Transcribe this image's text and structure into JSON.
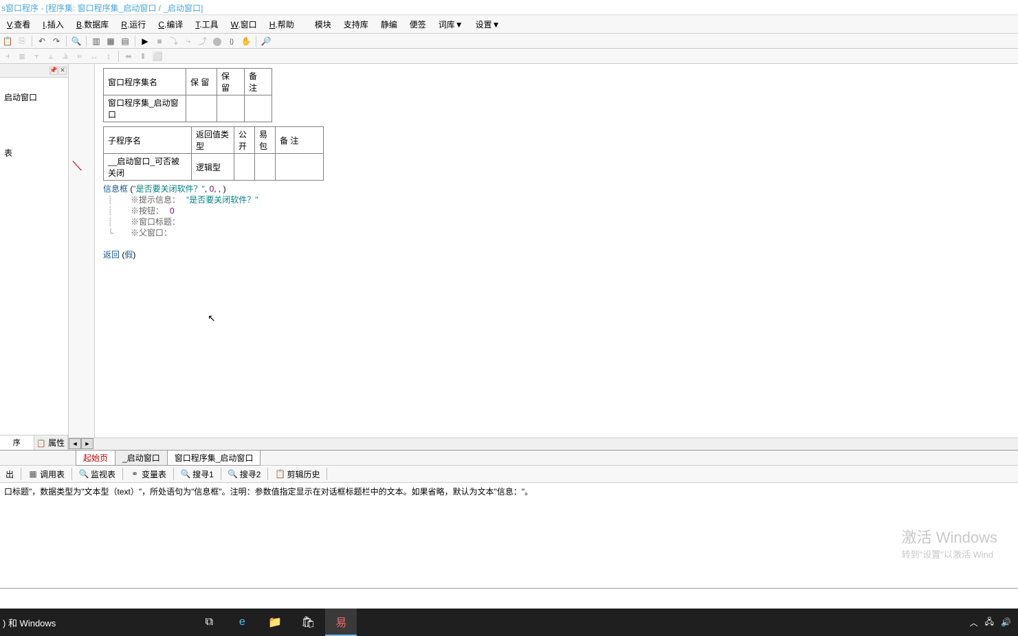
{
  "title": "s窗口程序 - [程序集: 窗口程序集_启动窗口 / _启动窗口]",
  "menu": {
    "view": "V.查看",
    "insert": "I.插入",
    "db": "B.数据库",
    "run": "R.运行",
    "compile": "C.编译",
    "tools": "T.工具",
    "window": "W.窗口",
    "help": "H.帮助",
    "module": "模块",
    "support": "支持库",
    "static": "静编",
    "notes": "便签",
    "dict": "词库▼",
    "settings": "设置▼"
  },
  "left_panel": {
    "item1": "启动窗口",
    "item2": "表",
    "tab_prog": "序",
    "tab_prop": "属性"
  },
  "table1": {
    "h1": "窗口程序集名",
    "h2": "保 留",
    "h3": "保 留",
    "h4": "备 注",
    "r1c1": "窗口程序集_启动窗口"
  },
  "table2": {
    "h1": "子程序名",
    "h2": "返回值类型",
    "h3": "公开",
    "h4": "易包",
    "h5": "备 注",
    "r1c1": "__启动窗口_可否被关闭",
    "r1c2": "逻辑型"
  },
  "code": {
    "call": "信息框",
    "open": " (",
    "str1": "\"是否要关闭软件？\"",
    "comma": ", ",
    "num0": "0",
    "close": ", , )",
    "p1_label": "※提示信息：",
    "p1_val": "\"是否要关闭软件？\"",
    "p2_label": "※按钮：",
    "p2_val": "0",
    "p3_label": "※窗口标题：",
    "p4_label": "※父窗口：",
    "ret": "返回",
    "ret_open": " (",
    "ret_val": "假",
    "ret_close": ")"
  },
  "tabs": {
    "start": "起始页",
    "win": "_启动窗口",
    "set": "窗口程序集_启动窗口"
  },
  "tools2": {
    "out": "出",
    "call": "调用表",
    "watch": "监视表",
    "var": "变量表",
    "find1": "搜寻1",
    "find2": "搜寻2",
    "clip": "剪辑历史"
  },
  "status": "口标题\"，数据类型为\"文本型（text）\"，所处语句为\"信息框\"。注明：参数值指定显示在对话框标题栏中的文本。如果省略，默认为文本\"信息：\"。",
  "watermark": {
    "l1": "激活 Windows",
    "l2": "转到\"设置\"以激活 Wind"
  },
  "taskbar": {
    "left": ") 和 Windows"
  }
}
